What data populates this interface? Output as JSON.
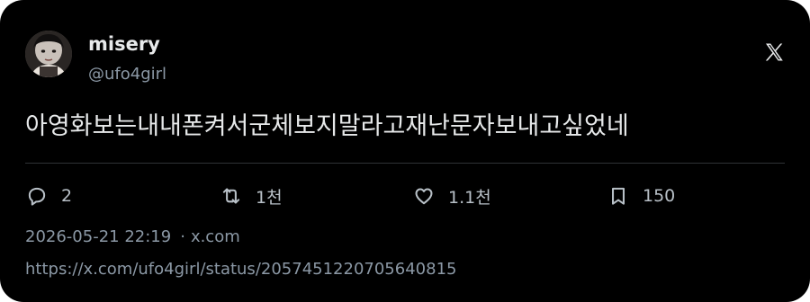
{
  "author": {
    "display_name": "misery",
    "handle": "@ufo4girl"
  },
  "tweet": {
    "text": "아영화보는내내폰켜서군체보지말라고재난문자보내고싶었네"
  },
  "actions": {
    "reply_count": "2",
    "retweet_count": "1천",
    "like_count": "1.1천",
    "bookmark_count": "150"
  },
  "meta": {
    "timestamp": "2026-05-21 22:19",
    "separator": "·",
    "source": "x.com",
    "status_url": "https://x.com/ufo4girl/status/2057451220705640815"
  },
  "icons": {
    "platform": "x-logo-icon",
    "reply": "reply-icon",
    "retweet": "retweet-icon",
    "like": "heart-icon",
    "bookmark": "bookmark-icon"
  },
  "colors": {
    "background": "#000000",
    "text": "#e7e9ea",
    "muted": "#8b98a5",
    "divider": "#2f3336"
  }
}
